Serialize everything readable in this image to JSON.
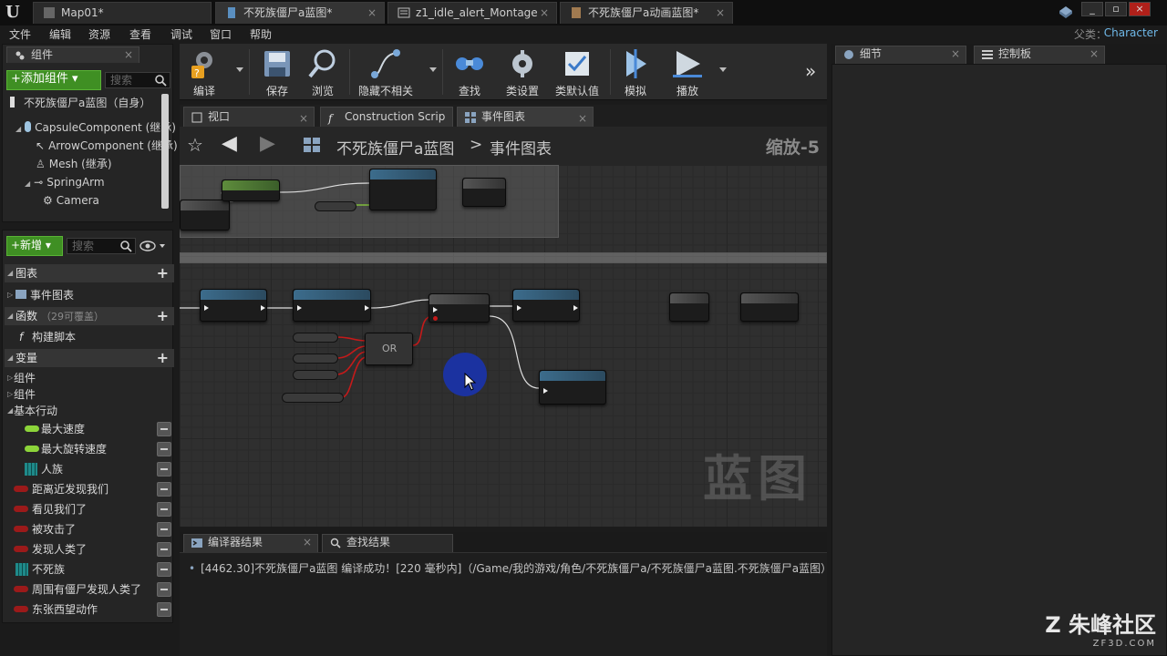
{
  "doc_tabs": [
    {
      "label": "Map01*",
      "icon": "level-icon"
    },
    {
      "label": "不死族僵尸a蓝图*",
      "icon": "blueprint-icon"
    },
    {
      "label": "z1_idle_alert_Montage",
      "icon": "montage-icon"
    },
    {
      "label": "不死族僵尸a动画蓝图*",
      "icon": "anim-blueprint-icon"
    }
  ],
  "menu": [
    "文件",
    "编辑",
    "资源",
    "查看",
    "调试",
    "窗口",
    "帮助"
  ],
  "parent": {
    "label": "父类：",
    "value": "Character"
  },
  "components_panel": {
    "tab": "组件",
    "add_button": "+添加组件 ▾",
    "search_placeholder": "搜索",
    "root": "不死族僵尸a蓝图（自身）",
    "tree": [
      "CapsuleComponent (继承)",
      "ArrowComponent (继承)",
      "Mesh (继承)",
      "SpringArm",
      "Camera"
    ]
  },
  "my_blueprint": {
    "new_button": "+新增 ▾",
    "search_placeholder": "搜索",
    "graphs_header": "图表",
    "event_graph": "事件图表",
    "functions_header": "函数",
    "functions_note": "（29可覆盖）",
    "construction_script": "构建脚本",
    "variables_header": "变量",
    "groups": [
      "组件",
      "组件"
    ],
    "basic_group": "基本行动",
    "variables": [
      {
        "name": "最大速度",
        "color": "#8cd43a",
        "kind": "pill"
      },
      {
        "name": "最大旋转速度",
        "color": "#8cd43a",
        "kind": "pill"
      },
      {
        "name": "人族",
        "color": "#1f8a8a",
        "kind": "grid"
      },
      {
        "name": "距离近发现我们",
        "color": "#9b1a1a",
        "kind": "pill"
      },
      {
        "name": "看见我们了",
        "color": "#9b1a1a",
        "kind": "pill"
      },
      {
        "name": "被攻击了",
        "color": "#9b1a1a",
        "kind": "pill"
      },
      {
        "name": "发现人类了",
        "color": "#9b1a1a",
        "kind": "pill"
      },
      {
        "name": "不死族",
        "color": "#1f8a8a",
        "kind": "grid"
      },
      {
        "name": "周围有僵尸发现人类了",
        "color": "#9b1a1a",
        "kind": "pill"
      },
      {
        "name": "东张西望动作",
        "color": "#9b1a1a",
        "kind": "pill"
      }
    ]
  },
  "toolbar": [
    {
      "label": "编译",
      "icon": "compile-icon"
    },
    {
      "label": "保存",
      "icon": "save-icon"
    },
    {
      "label": "浏览",
      "icon": "browse-icon"
    },
    {
      "label": "隐藏不相关",
      "icon": "hide-unrelated-icon"
    },
    {
      "label": "查找",
      "icon": "find-icon"
    },
    {
      "label": "类设置",
      "icon": "class-settings-icon"
    },
    {
      "label": "类默认值",
      "icon": "class-defaults-icon"
    },
    {
      "label": "模拟",
      "icon": "simulate-icon"
    },
    {
      "label": "播放",
      "icon": "play-icon"
    }
  ],
  "graph_tabs": [
    {
      "label": "视口",
      "icon": "viewport-icon"
    },
    {
      "label": "Construction Scrip",
      "icon": "function-icon"
    },
    {
      "label": "事件图表",
      "icon": "graph-icon"
    }
  ],
  "breadcrumb": {
    "blueprint": "不死族僵尸a蓝图",
    "sep": ">",
    "graph": "事件图表",
    "zoom": "缩放-5"
  },
  "graph_nodes": {
    "or_node": "OR",
    "watermark": "蓝图"
  },
  "bottom_tabs": [
    "编译器结果",
    "查找结果"
  ],
  "log_line": "[4462.30]不死族僵尸a蓝图 编译成功！[220 毫秒内]（/Game/我的游戏/角色/不死族僵尸a/不死族僵尸a蓝图.不死族僵尸a蓝图）",
  "right_tabs": [
    "细节",
    "控制板"
  ],
  "logo": {
    "text": "朱峰社区",
    "url_text": "ZF3D.COM"
  }
}
